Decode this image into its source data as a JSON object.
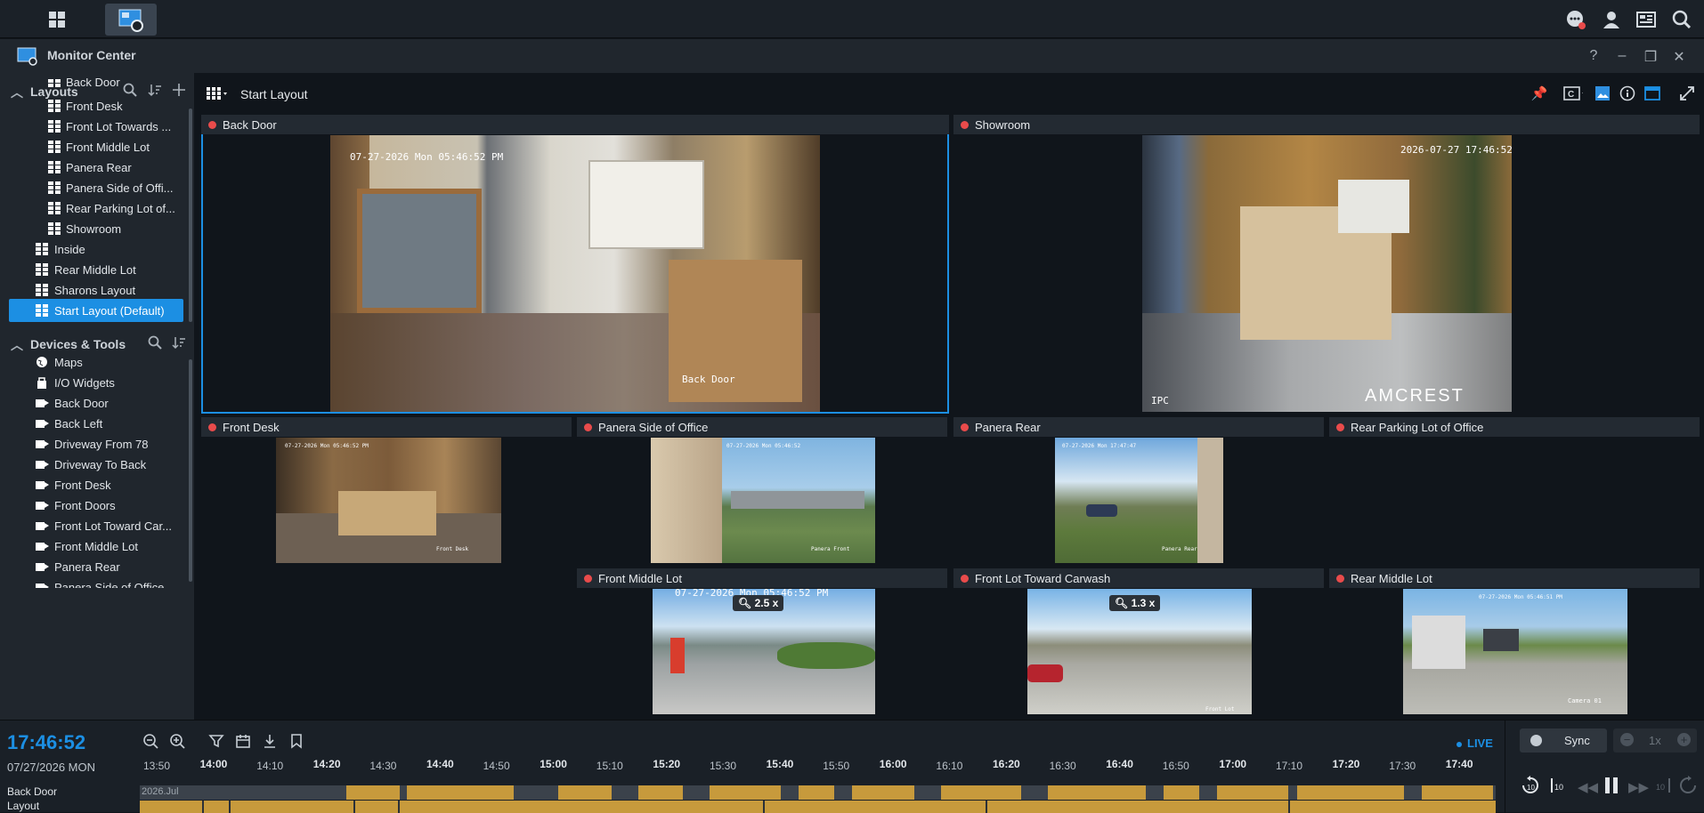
{
  "titlebar": {
    "title": "Monitor Center",
    "help": "?",
    "minimize": "–",
    "restore": "❐",
    "close": "✕"
  },
  "sidebar": {
    "layouts_header": "Layouts",
    "layout_items": [
      {
        "label": "Back Door"
      },
      {
        "label": "Front Desk"
      },
      {
        "label": "Front Lot Towards ..."
      },
      {
        "label": "Front Middle Lot"
      },
      {
        "label": "Panera Rear"
      },
      {
        "label": "Panera Side of Offi..."
      },
      {
        "label": "Rear Parking Lot of..."
      },
      {
        "label": "Showroom"
      },
      {
        "label": "Inside"
      },
      {
        "label": "Rear Middle Lot"
      },
      {
        "label": "Sharons Layout"
      },
      {
        "label": "Start Layout (Default)"
      }
    ],
    "devices_header": "Devices & Tools",
    "device_items": [
      {
        "label": "Maps"
      },
      {
        "label": "I/O Widgets"
      },
      {
        "label": "Back Door"
      },
      {
        "label": "Back Left"
      },
      {
        "label": "Driveway From 78"
      },
      {
        "label": "Driveway To Back"
      },
      {
        "label": "Front Desk"
      },
      {
        "label": "Front Doors"
      },
      {
        "label": "Front Lot Toward Car..."
      },
      {
        "label": "Front Middle Lot"
      },
      {
        "label": "Panera Rear"
      },
      {
        "label": "Panera Side of Office"
      }
    ]
  },
  "main": {
    "layout_title": "Start Layout"
  },
  "tiles": [
    {
      "name": "Back Door",
      "osd": "07-27-2026 Mon 05:46:52 PM",
      "osd2": "Back Door"
    },
    {
      "name": "Showroom",
      "osd": "2026-07-27 17:46:52",
      "osd2": "IPC",
      "brand": "AMCREST"
    },
    {
      "name": "Front Desk",
      "osd": "07-27-2026 Mon 05:46:52 PM",
      "osd2": "Front Desk"
    },
    {
      "name": "Panera Side of Office",
      "osd": "07-27-2026 Mon 05:46:52",
      "osd2": "Panera Front"
    },
    {
      "name": "Panera Rear",
      "osd": "07-27-2026 Mon 17:47:47",
      "osd2": "Panera Rear"
    },
    {
      "name": "Rear Parking Lot of Office"
    },
    {
      "name": "Front Middle Lot",
      "osd": "07-27-2026 Mon 05:46:52 PM",
      "zoom": "2.5 x"
    },
    {
      "name": "Front Lot Toward Carwash",
      "zoom": "1.3 x",
      "osd2": "Front Lot"
    },
    {
      "name": "Rear Middle Lot",
      "osd": "07-27-2026 Mon 05:46:51 PM",
      "osd2": "Camera 01"
    }
  ],
  "timeline": {
    "time": "17:46:52",
    "date": "07/27/2026 MON",
    "live": "LIVE",
    "sync": "Sync",
    "speed": "1x",
    "ticks": [
      "13:50",
      "14:00",
      "14:10",
      "14:20",
      "14:30",
      "14:40",
      "14:50",
      "15:00",
      "15:10",
      "15:20",
      "15:30",
      "15:40",
      "15:50",
      "16:00",
      "16:10",
      "16:20",
      "16:30",
      "16:40",
      "16:50",
      "17:00",
      "17:10",
      "17:20",
      "17:30",
      "17:40"
    ],
    "rows": [
      {
        "label": "Back Door",
        "date_tag": "2026.Jul"
      },
      {
        "label": "Layout"
      }
    ]
  },
  "colors": {
    "accent": "#1c8fe3",
    "record": "#c79a3c",
    "live_dot": "#e94b4b"
  }
}
